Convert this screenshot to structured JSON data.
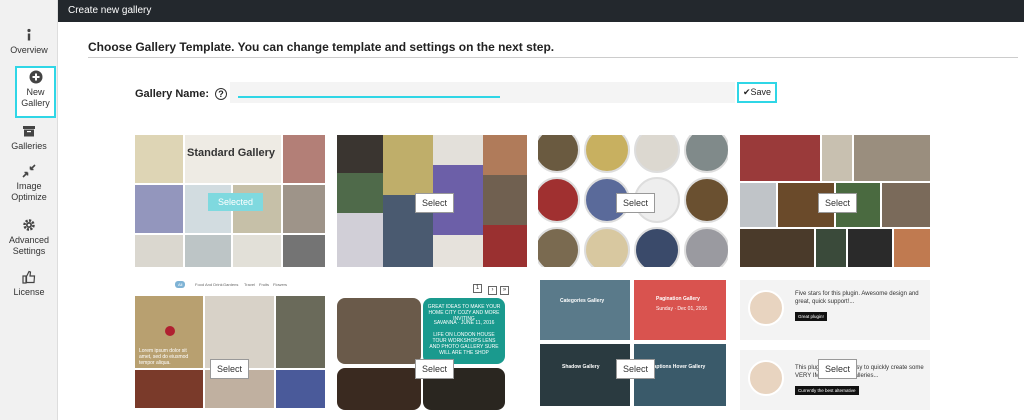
{
  "sidebar": {
    "items": [
      {
        "label": "Overview",
        "icon": "info-icon"
      },
      {
        "label": "New Gallery",
        "icon": "plus-circle-icon"
      },
      {
        "label": "Galleries",
        "icon": "archive-icon"
      },
      {
        "label": "Image Optimize",
        "icon": "compress-icon"
      },
      {
        "label": "Advanced Settings",
        "icon": "gear-icon"
      },
      {
        "label": "License",
        "icon": "thumbs-up-icon"
      }
    ]
  },
  "topbar": {
    "title": "Create new gallery"
  },
  "main": {
    "heading": "Choose Gallery Template. You can change template and settings on the next step.",
    "gallery_name_label": "Gallery Name:",
    "help_glyph": "?",
    "gallery_name_value": "",
    "save_label": "Save",
    "save_glyph": "✔"
  },
  "templates": {
    "standard_title": "Standard Gallery",
    "selected_label": "Selected",
    "select_label": "Select",
    "pager": [
      "1",
      "›",
      "»"
    ],
    "filter_tabs": [
      "All",
      "Food And Drink",
      "Gardens",
      "Travel",
      "Fruits",
      "Flowers"
    ],
    "captions": {
      "categories": "Categories Gallery",
      "pagination": "Pagination Gallery",
      "pagination_date": "Sunday · Dec 01, 2016",
      "shadow": "Shadow Gallery",
      "captions_hover": "Captions Hover Gallery",
      "banner_title": "GREAT IDEAS TO MAKE YOUR HOME CITY COZY AND MORE INVITING",
      "banner_date": "SAVANNA · JUNE 11, 2016",
      "banner_text": "LIFE ON LONDON HOUSE TOUR WORKSHOPS LENS AND PHOTO GALLERY SURE WILL ARE THE SHOP",
      "blog_text": "Lorem ipsum dolor sit amet, sed do eiusmod tempor aliqua."
    },
    "review1": {
      "text": "Five stars for this plugin. Awesome design and great, quick support!...",
      "button": "Great plugin!"
    },
    "review2": {
      "text": "This plugin makes it easy to quickly create some VERY IMPRESSIVE galleries...",
      "button": "Currently the best alternative"
    }
  },
  "colors": {
    "accent": "#2fd6e6",
    "topbar": "#23282d",
    "selected": "#7fd9df"
  }
}
